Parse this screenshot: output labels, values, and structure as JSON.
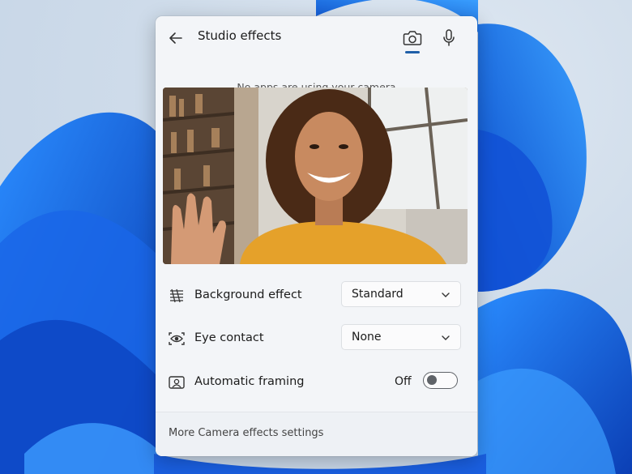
{
  "header": {
    "title": "Studio effects",
    "back_icon": "back-arrow-icon",
    "tabs": [
      {
        "icon": "camera-icon",
        "selected": true
      },
      {
        "icon": "microphone-icon",
        "selected": false
      }
    ]
  },
  "status_text": "No apps are using your camera",
  "settings": {
    "background_effect": {
      "label": "Background effect",
      "value": "Standard",
      "icon": "background-blur-icon"
    },
    "eye_contact": {
      "label": "Eye contact",
      "value": "None",
      "icon": "eye-contact-icon"
    },
    "automatic_framing": {
      "label": "Automatic framing",
      "state": "Off",
      "icon": "framing-icon"
    }
  },
  "footer": {
    "link": "More Camera effects settings"
  },
  "colors": {
    "accent": "#1f5fa8",
    "wallpaper": "#1565e0"
  }
}
